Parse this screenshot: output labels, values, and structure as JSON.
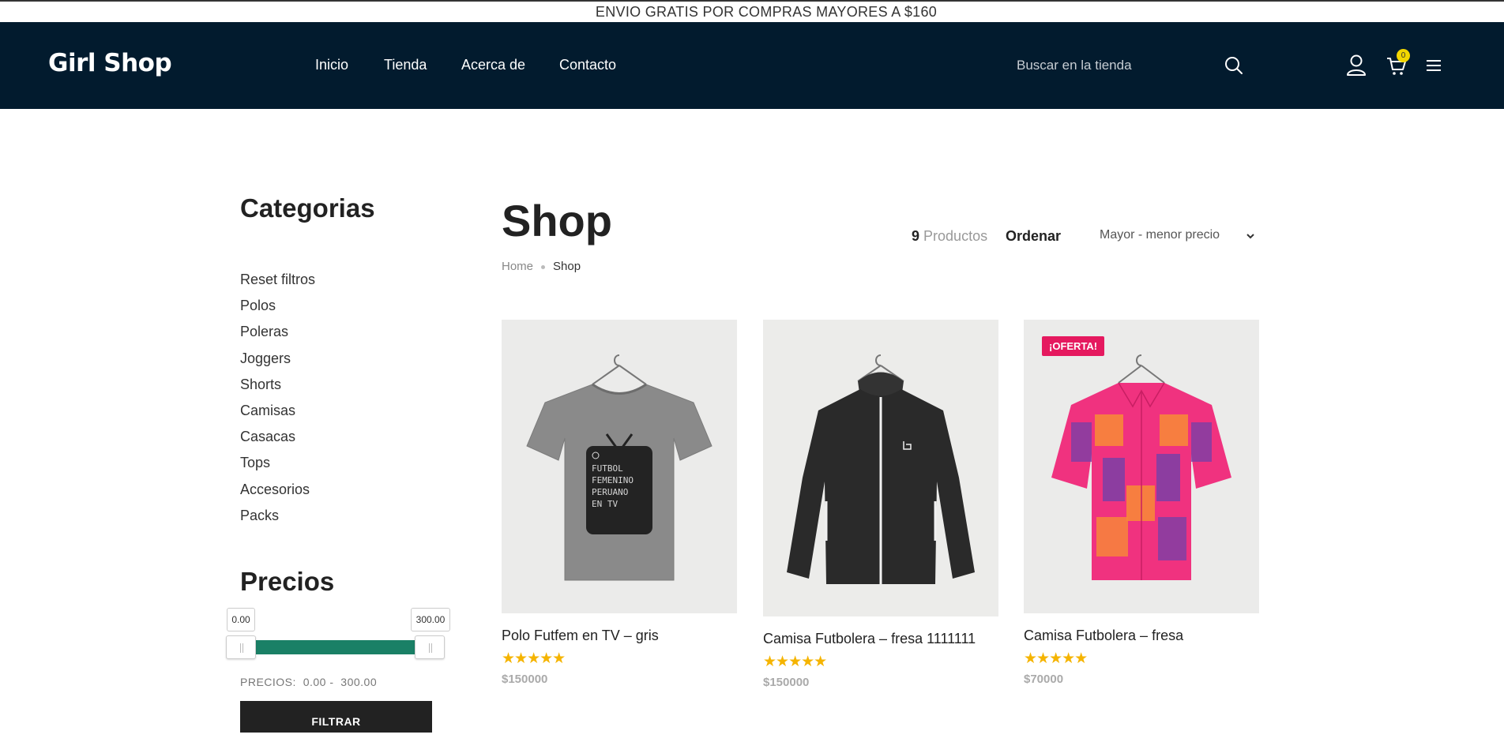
{
  "announcement": "ENVIO GRATIS POR COMPRAS MAYORES A $160",
  "header": {
    "logo": "Girl Shop",
    "nav": [
      {
        "label": "Inicio"
      },
      {
        "label": "Tienda"
      },
      {
        "label": "Acerca de"
      },
      {
        "label": "Contacto"
      }
    ],
    "search_placeholder": "Buscar en la tienda",
    "cart_count": "0",
    "icons": [
      "search-icon",
      "user-icon",
      "cart-icon",
      "menu-icon"
    ]
  },
  "sidebar": {
    "categories_title": "Categorias",
    "categories": [
      "Reset filtros",
      "Polos",
      "Poleras",
      "Joggers",
      "Shorts",
      "Camisas",
      "Casacas",
      "Tops",
      "Accesorios",
      "Packs"
    ],
    "prices_title": "Precios",
    "price_min": "0.00",
    "price_max": "300.00",
    "price_range_label": "PRECIOS:",
    "price_range_from": "0.00",
    "price_range_separator": "-",
    "price_range_to": "300.00",
    "filter_label": "FILTRAR",
    "slider_fill_fraction": 1.0
  },
  "main": {
    "title": "Shop",
    "breadcrumb": {
      "home": "Home",
      "current": "Shop"
    },
    "product_count": "9",
    "product_count_label": "Productos",
    "order_label": "Ordenar",
    "order_value": "Mayor - menor precio"
  },
  "products": [
    {
      "name": "Polo Futfem en TV – gris",
      "price": "$150000",
      "rating": 5,
      "stars": "★★★★★",
      "badge": ""
    },
    {
      "name": "Camisa Futbolera – fresa 1111111",
      "price": "$150000",
      "rating": 5,
      "stars": "★★★★★",
      "badge": ""
    },
    {
      "name": "Camisa Futbolera – fresa",
      "price": "$70000",
      "rating": 5,
      "stars": "★★★★★",
      "badge": "¡OFERTA!"
    }
  ],
  "tv_print": [
    "FUTBOL",
    "FEMENINO",
    "PERUANO",
    "EN TV"
  ],
  "colors": {
    "header_bg": "#021b2e",
    "slider": "#1a8066",
    "badge": "#e5195f",
    "stars": "#f5b400",
    "cart_badge": "#f2d600"
  }
}
